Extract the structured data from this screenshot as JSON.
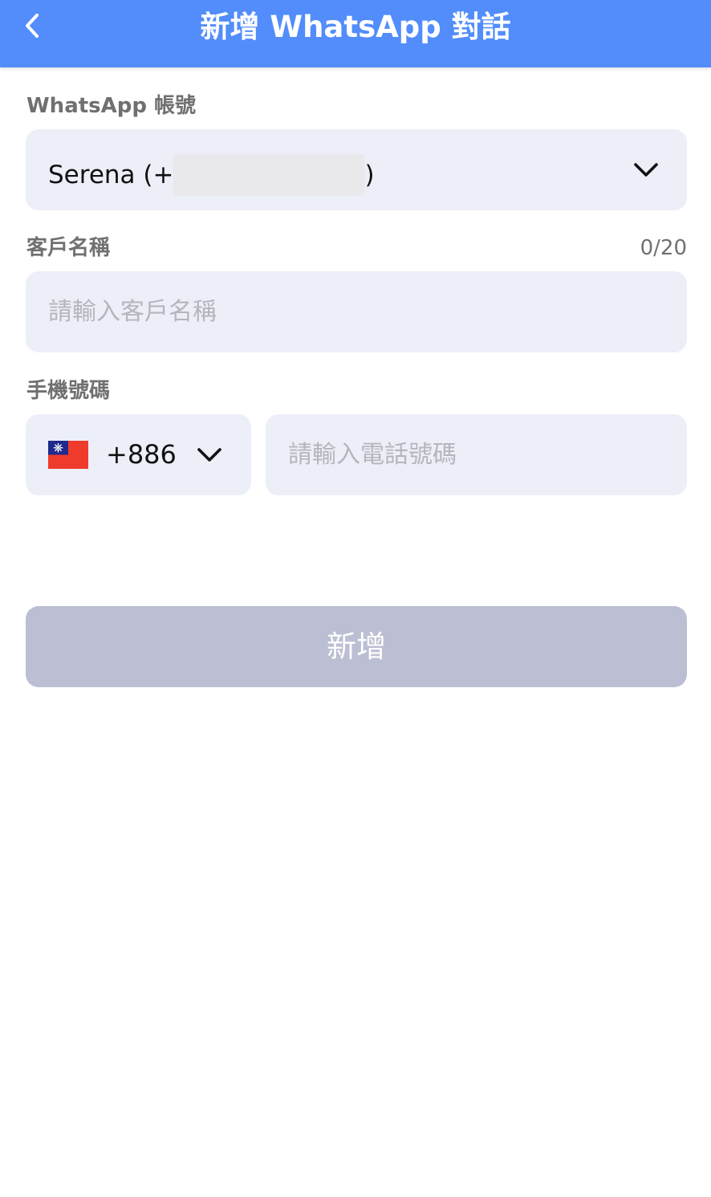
{
  "header": {
    "title": "新增 WhatsApp 對話",
    "back_icon": "chevron-left-icon",
    "background_color": "#528dfb"
  },
  "account": {
    "label": "WhatsApp 帳號",
    "selected_prefix": "Serena (+",
    "selected_suffix": ")",
    "dropdown_icon": "chevron-down-icon"
  },
  "customer_name": {
    "label": "客戶名稱",
    "counter": "0/20",
    "value": "",
    "placeholder": "請輸入客戶名稱"
  },
  "phone": {
    "label": "手機號碼",
    "country_flag": "taiwan-flag-icon",
    "dial_code": "+886",
    "dropdown_icon": "chevron-down-icon",
    "value": "",
    "placeholder": "請輸入電話號碼"
  },
  "submit": {
    "label": "新增",
    "disabled_color": "#bcbfd3"
  }
}
